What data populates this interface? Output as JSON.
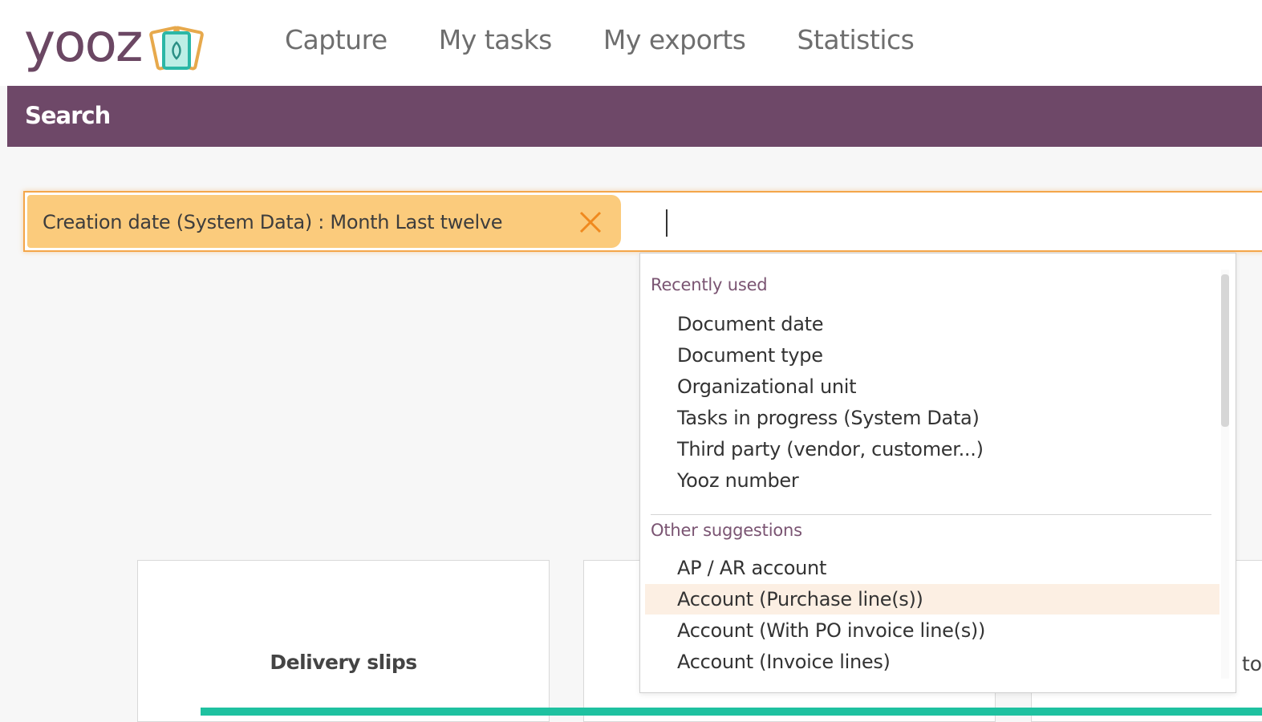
{
  "app": {
    "logo_text": "yooz"
  },
  "nav": {
    "items": [
      {
        "label": "Capture"
      },
      {
        "label": "My tasks"
      },
      {
        "label": "My exports"
      },
      {
        "label": "Statistics"
      }
    ]
  },
  "search": {
    "section_title": "Search",
    "filter_chip": {
      "label": "Creation date (System Data) : Month Last twelve",
      "close_icon": "close-icon"
    },
    "input_value": ""
  },
  "dropdown": {
    "recent_title": "Recently used",
    "recent_items": [
      "Document date",
      "Document type",
      "Organizational unit",
      "Tasks in progress (System Data)",
      "Third party (vendor, customer...)",
      "Yooz number"
    ],
    "other_title": "Other suggestions",
    "other_items": [
      "AP / AR account",
      "Account (Purchase line(s))",
      "Account (With PO invoice line(s))",
      "Account (Invoice lines)"
    ],
    "highlighted": "Account (Purchase line(s))"
  },
  "tiles": {
    "first_label": "Delivery slips",
    "partial_text": "to"
  },
  "colors": {
    "brand": "#6e4868",
    "chip": "#fbcb7c",
    "accent_orange": "#f4a64a",
    "teal": "#1fc1a0"
  }
}
